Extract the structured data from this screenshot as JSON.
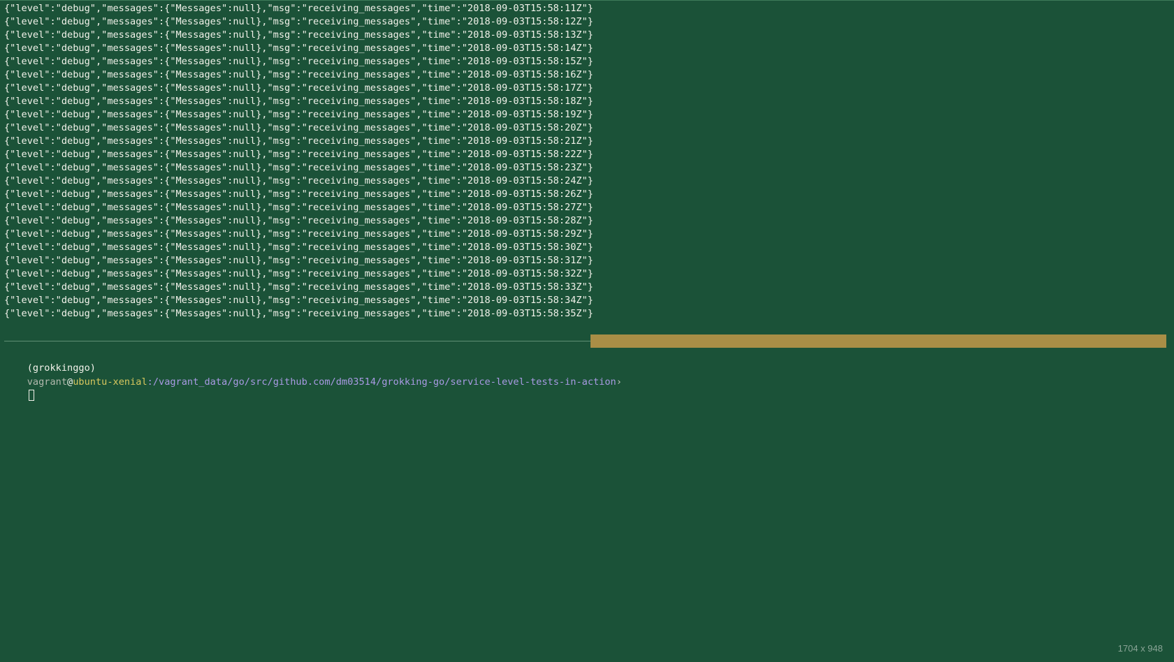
{
  "terminal": {
    "log_lines": [
      "{\"level\":\"debug\",\"messages\":{\"Messages\":null},\"msg\":\"receiving_messages\",\"time\":\"2018-09-03T15:58:11Z\"}",
      "{\"level\":\"debug\",\"messages\":{\"Messages\":null},\"msg\":\"receiving_messages\",\"time\":\"2018-09-03T15:58:12Z\"}",
      "{\"level\":\"debug\",\"messages\":{\"Messages\":null},\"msg\":\"receiving_messages\",\"time\":\"2018-09-03T15:58:13Z\"}",
      "{\"level\":\"debug\",\"messages\":{\"Messages\":null},\"msg\":\"receiving_messages\",\"time\":\"2018-09-03T15:58:14Z\"}",
      "{\"level\":\"debug\",\"messages\":{\"Messages\":null},\"msg\":\"receiving_messages\",\"time\":\"2018-09-03T15:58:15Z\"}",
      "{\"level\":\"debug\",\"messages\":{\"Messages\":null},\"msg\":\"receiving_messages\",\"time\":\"2018-09-03T15:58:16Z\"}",
      "{\"level\":\"debug\",\"messages\":{\"Messages\":null},\"msg\":\"receiving_messages\",\"time\":\"2018-09-03T15:58:17Z\"}",
      "{\"level\":\"debug\",\"messages\":{\"Messages\":null},\"msg\":\"receiving_messages\",\"time\":\"2018-09-03T15:58:18Z\"}",
      "{\"level\":\"debug\",\"messages\":{\"Messages\":null},\"msg\":\"receiving_messages\",\"time\":\"2018-09-03T15:58:19Z\"}",
      "{\"level\":\"debug\",\"messages\":{\"Messages\":null},\"msg\":\"receiving_messages\",\"time\":\"2018-09-03T15:58:20Z\"}",
      "{\"level\":\"debug\",\"messages\":{\"Messages\":null},\"msg\":\"receiving_messages\",\"time\":\"2018-09-03T15:58:21Z\"}",
      "{\"level\":\"debug\",\"messages\":{\"Messages\":null},\"msg\":\"receiving_messages\",\"time\":\"2018-09-03T15:58:22Z\"}",
      "{\"level\":\"debug\",\"messages\":{\"Messages\":null},\"msg\":\"receiving_messages\",\"time\":\"2018-09-03T15:58:23Z\"}",
      "{\"level\":\"debug\",\"messages\":{\"Messages\":null},\"msg\":\"receiving_messages\",\"time\":\"2018-09-03T15:58:24Z\"}",
      "{\"level\":\"debug\",\"messages\":{\"Messages\":null},\"msg\":\"receiving_messages\",\"time\":\"2018-09-03T15:58:26Z\"}",
      "{\"level\":\"debug\",\"messages\":{\"Messages\":null},\"msg\":\"receiving_messages\",\"time\":\"2018-09-03T15:58:27Z\"}",
      "{\"level\":\"debug\",\"messages\":{\"Messages\":null},\"msg\":\"receiving_messages\",\"time\":\"2018-09-03T15:58:28Z\"}",
      "{\"level\":\"debug\",\"messages\":{\"Messages\":null},\"msg\":\"receiving_messages\",\"time\":\"2018-09-03T15:58:29Z\"}",
      "{\"level\":\"debug\",\"messages\":{\"Messages\":null},\"msg\":\"receiving_messages\",\"time\":\"2018-09-03T15:58:30Z\"}",
      "{\"level\":\"debug\",\"messages\":{\"Messages\":null},\"msg\":\"receiving_messages\",\"time\":\"2018-09-03T15:58:31Z\"}",
      "{\"level\":\"debug\",\"messages\":{\"Messages\":null},\"msg\":\"receiving_messages\",\"time\":\"2018-09-03T15:58:32Z\"}",
      "{\"level\":\"debug\",\"messages\":{\"Messages\":null},\"msg\":\"receiving_messages\",\"time\":\"2018-09-03T15:58:33Z\"}",
      "{\"level\":\"debug\",\"messages\":{\"Messages\":null},\"msg\":\"receiving_messages\",\"time\":\"2018-09-03T15:58:34Z\"}",
      "{\"level\":\"debug\",\"messages\":{\"Messages\":null},\"msg\":\"receiving_messages\",\"time\":\"2018-09-03T15:58:35Z\"}"
    ],
    "prompt": {
      "env": "(grokkinggo)",
      "user": "vagrant",
      "at": "@",
      "host": "ubuntu-xenial",
      "path": ":/vagrant_data/go/src/github.com/dm03514/grokking-go/service-level-tests-in-action",
      "arrow": "›"
    },
    "dimensions_label": "1704 x 948"
  },
  "colors": {
    "background": "#1b5238",
    "text": "#f2f2ea",
    "status_bar": "#a98e46",
    "host": "#d8c75e",
    "path": "#a99ae4"
  }
}
